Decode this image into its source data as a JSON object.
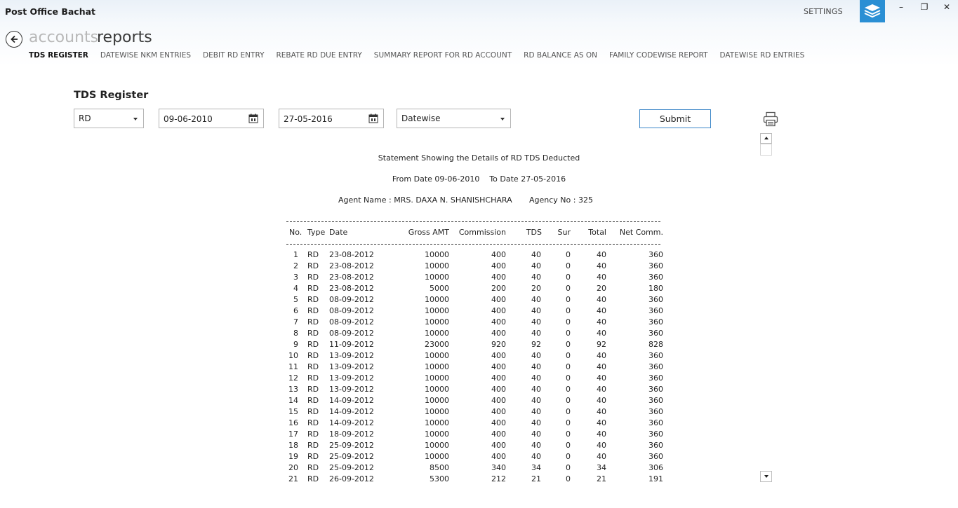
{
  "app": {
    "title": "Post Office Bachat",
    "settings_label": "SETTINGS"
  },
  "window_controls": {
    "minimize": "–",
    "restore": "❐",
    "close": "✕"
  },
  "breadcrumb": {
    "parent": "accounts",
    "current": "reports"
  },
  "tabs": [
    {
      "label": "TDS REGISTER",
      "active": true
    },
    {
      "label": "DATEWISE NKM ENTRIES",
      "active": false
    },
    {
      "label": "DEBIT RD ENTRY",
      "active": false
    },
    {
      "label": "REBATE RD DUE ENTRY",
      "active": false
    },
    {
      "label": "SUMMARY REPORT FOR RD ACCOUNT",
      "active": false
    },
    {
      "label": "RD BALANCE AS ON",
      "active": false
    },
    {
      "label": "FAMILY CODEWISE REPORT",
      "active": false
    },
    {
      "label": "DATEWISE RD ENTRIES",
      "active": false
    }
  ],
  "form": {
    "title": "TDS Register",
    "account_type": "RD",
    "from_date": "09-06-2010",
    "to_date": "27-05-2016",
    "mode": "Datewise",
    "submit_label": "Submit"
  },
  "report": {
    "heading": "Statement Showing the Details of RD TDS Deducted",
    "date_range": "From Date 09-06-2010    To Date 27-05-2016",
    "agent_name": "Agent Name : MRS. DAXA N. SHANISHCHARA",
    "agency_no": "Agency No : 325",
    "columns": [
      "No.",
      "Type",
      "Date",
      "Gross AMT",
      "Commission",
      "TDS",
      "Sur",
      "Total",
      "Net Comm."
    ],
    "rows": [
      [
        "1",
        "RD",
        "23-08-2012",
        "10000",
        "400",
        "40",
        "0",
        "40",
        "360"
      ],
      [
        "2",
        "RD",
        "23-08-2012",
        "10000",
        "400",
        "40",
        "0",
        "40",
        "360"
      ],
      [
        "3",
        "RD",
        "23-08-2012",
        "10000",
        "400",
        "40",
        "0",
        "40",
        "360"
      ],
      [
        "4",
        "RD",
        "23-08-2012",
        "5000",
        "200",
        "20",
        "0",
        "20",
        "180"
      ],
      [
        "5",
        "RD",
        "08-09-2012",
        "10000",
        "400",
        "40",
        "0",
        "40",
        "360"
      ],
      [
        "6",
        "RD",
        "08-09-2012",
        "10000",
        "400",
        "40",
        "0",
        "40",
        "360"
      ],
      [
        "7",
        "RD",
        "08-09-2012",
        "10000",
        "400",
        "40",
        "0",
        "40",
        "360"
      ],
      [
        "8",
        "RD",
        "08-09-2012",
        "10000",
        "400",
        "40",
        "0",
        "40",
        "360"
      ],
      [
        "9",
        "RD",
        "11-09-2012",
        "23000",
        "920",
        "92",
        "0",
        "92",
        "828"
      ],
      [
        "10",
        "RD",
        "13-09-2012",
        "10000",
        "400",
        "40",
        "0",
        "40",
        "360"
      ],
      [
        "11",
        "RD",
        "13-09-2012",
        "10000",
        "400",
        "40",
        "0",
        "40",
        "360"
      ],
      [
        "12",
        "RD",
        "13-09-2012",
        "10000",
        "400",
        "40",
        "0",
        "40",
        "360"
      ],
      [
        "13",
        "RD",
        "13-09-2012",
        "10000",
        "400",
        "40",
        "0",
        "40",
        "360"
      ],
      [
        "14",
        "RD",
        "14-09-2012",
        "10000",
        "400",
        "40",
        "0",
        "40",
        "360"
      ],
      [
        "15",
        "RD",
        "14-09-2012",
        "10000",
        "400",
        "40",
        "0",
        "40",
        "360"
      ],
      [
        "16",
        "RD",
        "14-09-2012",
        "10000",
        "400",
        "40",
        "0",
        "40",
        "360"
      ],
      [
        "17",
        "RD",
        "18-09-2012",
        "10000",
        "400",
        "40",
        "0",
        "40",
        "360"
      ],
      [
        "18",
        "RD",
        "25-09-2012",
        "10000",
        "400",
        "40",
        "0",
        "40",
        "360"
      ],
      [
        "19",
        "RD",
        "25-09-2012",
        "10000",
        "400",
        "40",
        "0",
        "40",
        "360"
      ],
      [
        "20",
        "RD",
        "25-09-2012",
        "8500",
        "340",
        "34",
        "0",
        "34",
        "306"
      ],
      [
        "21",
        "RD",
        "26-09-2012",
        "5300",
        "212",
        "21",
        "0",
        "21",
        "191"
      ]
    ]
  },
  "colors": {
    "accent": "#2a8fd4",
    "submit_border": "#3b86c8"
  },
  "icons": [
    "back-arrow-icon",
    "layers-icon",
    "calendar-icon",
    "chevron-down-icon",
    "printer-icon"
  ]
}
